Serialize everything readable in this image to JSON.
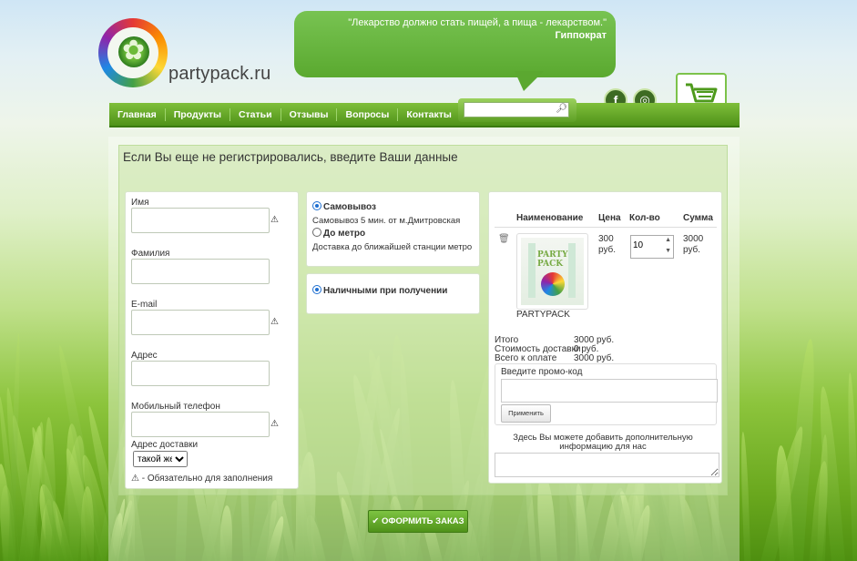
{
  "site": {
    "logo_text": "partypack.ru"
  },
  "quote": {
    "text": "\"Лекарство должно стать пищей, а пища - лекарством.\"",
    "author": "Гиппократ"
  },
  "nav": {
    "items": [
      "Главная",
      "Продукты",
      "Статьи",
      "Отзывы",
      "Вопросы",
      "Контакты"
    ]
  },
  "search": {
    "value": ""
  },
  "social": {
    "facebook": "f",
    "instagram": "◎"
  },
  "page": {
    "heading": "Если Вы еще не регистрировались, введите Ваши данные"
  },
  "form": {
    "name_label": "Имя",
    "surname_label": "Фамилия",
    "email_label": "E-mail",
    "address_label": "Адрес",
    "phone_label": "Мобильный телефон",
    "delivery_address_label": "Адрес доставки",
    "delivery_address_select": "такой же",
    "required_note": "- Обязательно для заполнения"
  },
  "delivery": {
    "option1_label": "Самовывоз",
    "option1_desc": "Самовывоз 5 мин. от м.Дмитровская",
    "option2_label": "До метро",
    "option2_desc": "Доставка до ближайшей станции метро"
  },
  "payment": {
    "option1_label": "Наличными при получении"
  },
  "cart": {
    "headers": {
      "name": "Наименование",
      "price": "Цена",
      "qty": "Кол-во",
      "sum": "Сумма"
    },
    "item": {
      "name": "PARTYPACK",
      "price": "300 руб.",
      "qty": "10",
      "sum": "3000 руб.",
      "image_text": "PARTY PACK"
    },
    "totals": {
      "total_label": "Итого",
      "total_value": "3000 руб.",
      "delivery_label": "Стоимость доставки",
      "delivery_value": "0 руб.",
      "pay_label": "Всего к оплате",
      "pay_value": "3000 руб."
    },
    "promo": {
      "label": "Введите промо-код",
      "button": "Применить"
    },
    "comment_label": "Здесь Вы можете добавить дополнительную информацию для нас"
  },
  "order_button": "✔ ОФОРМИТЬ ЗАКАЗ",
  "colors": {
    "accent": "#5aa92f",
    "nav": "#4f9219"
  }
}
